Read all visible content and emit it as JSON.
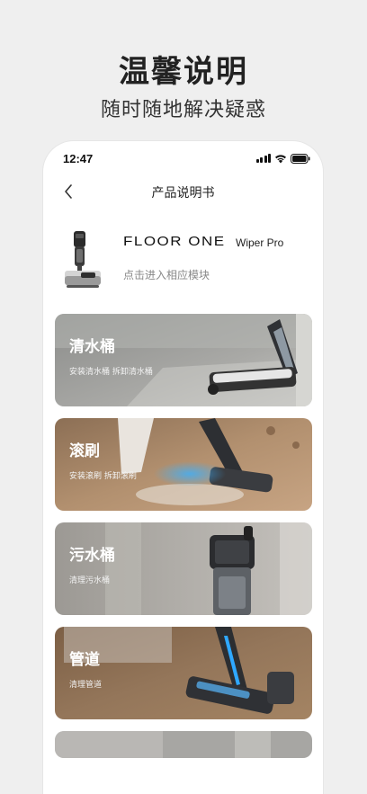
{
  "promo": {
    "title": "温馨说明",
    "subtitle": "随时随地解决疑惑"
  },
  "status_bar": {
    "time": "12:47"
  },
  "nav": {
    "title": "产品说明书",
    "back_icon": "chevron-left-icon"
  },
  "product": {
    "brand": "FLOOR ONE",
    "model": "Wiper Pro",
    "hint": "点击进入相应模块"
  },
  "cards": [
    {
      "title": "清水桶",
      "subtitle": "安装清水桶 拆卸清水桶"
    },
    {
      "title": "滚刷",
      "subtitle": "安装滚刷 拆卸滚刷"
    },
    {
      "title": "污水桶",
      "subtitle": "清理污水桶"
    },
    {
      "title": "管道",
      "subtitle": "清理管道"
    }
  ],
  "colors": {
    "card1": "#9a9a98",
    "card2": "#a9876a",
    "card3": "#a2a09c",
    "card4": "#8a6c50"
  }
}
